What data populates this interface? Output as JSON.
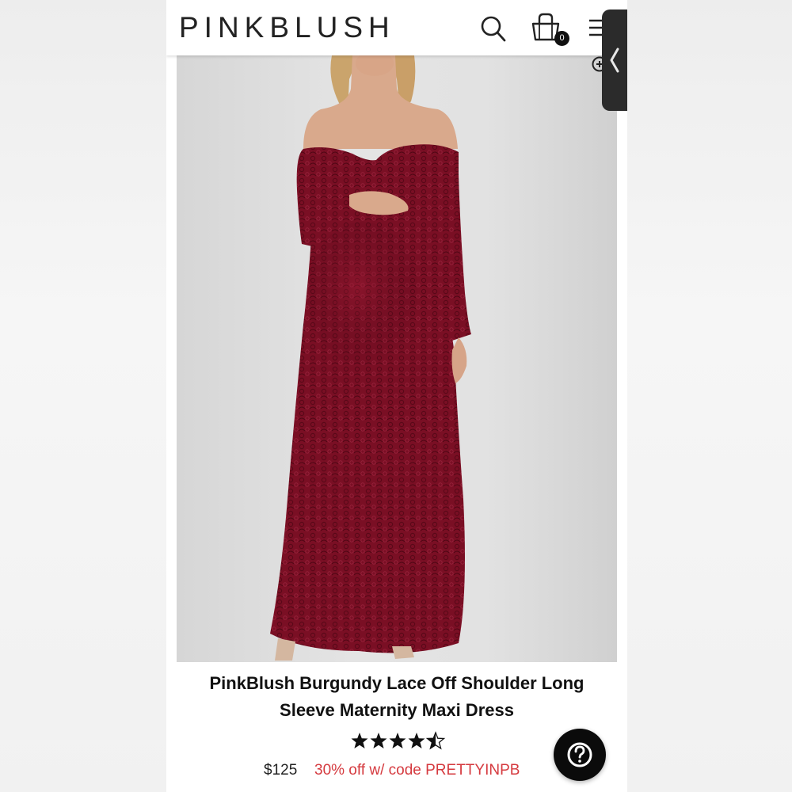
{
  "header": {
    "logo": "PINKBLUSH",
    "cart_count": "0"
  },
  "product": {
    "title": "PinkBlush Burgundy Lace Off Shoulder Long Sleeve Maternity Maxi Dress",
    "rating": 4.5,
    "rating_max": 5,
    "price": "$125",
    "promo": "30% off w/ code PRETTYINPB"
  },
  "colors": {
    "dress": "#7a0f24",
    "promo": "#d53a3f",
    "background": "#e2e2e2"
  },
  "icons": [
    "search-icon",
    "shopping-bag-icon",
    "menu-icon",
    "zoom-in-icon",
    "chevron-left-icon",
    "help-icon",
    "star-icon"
  ]
}
